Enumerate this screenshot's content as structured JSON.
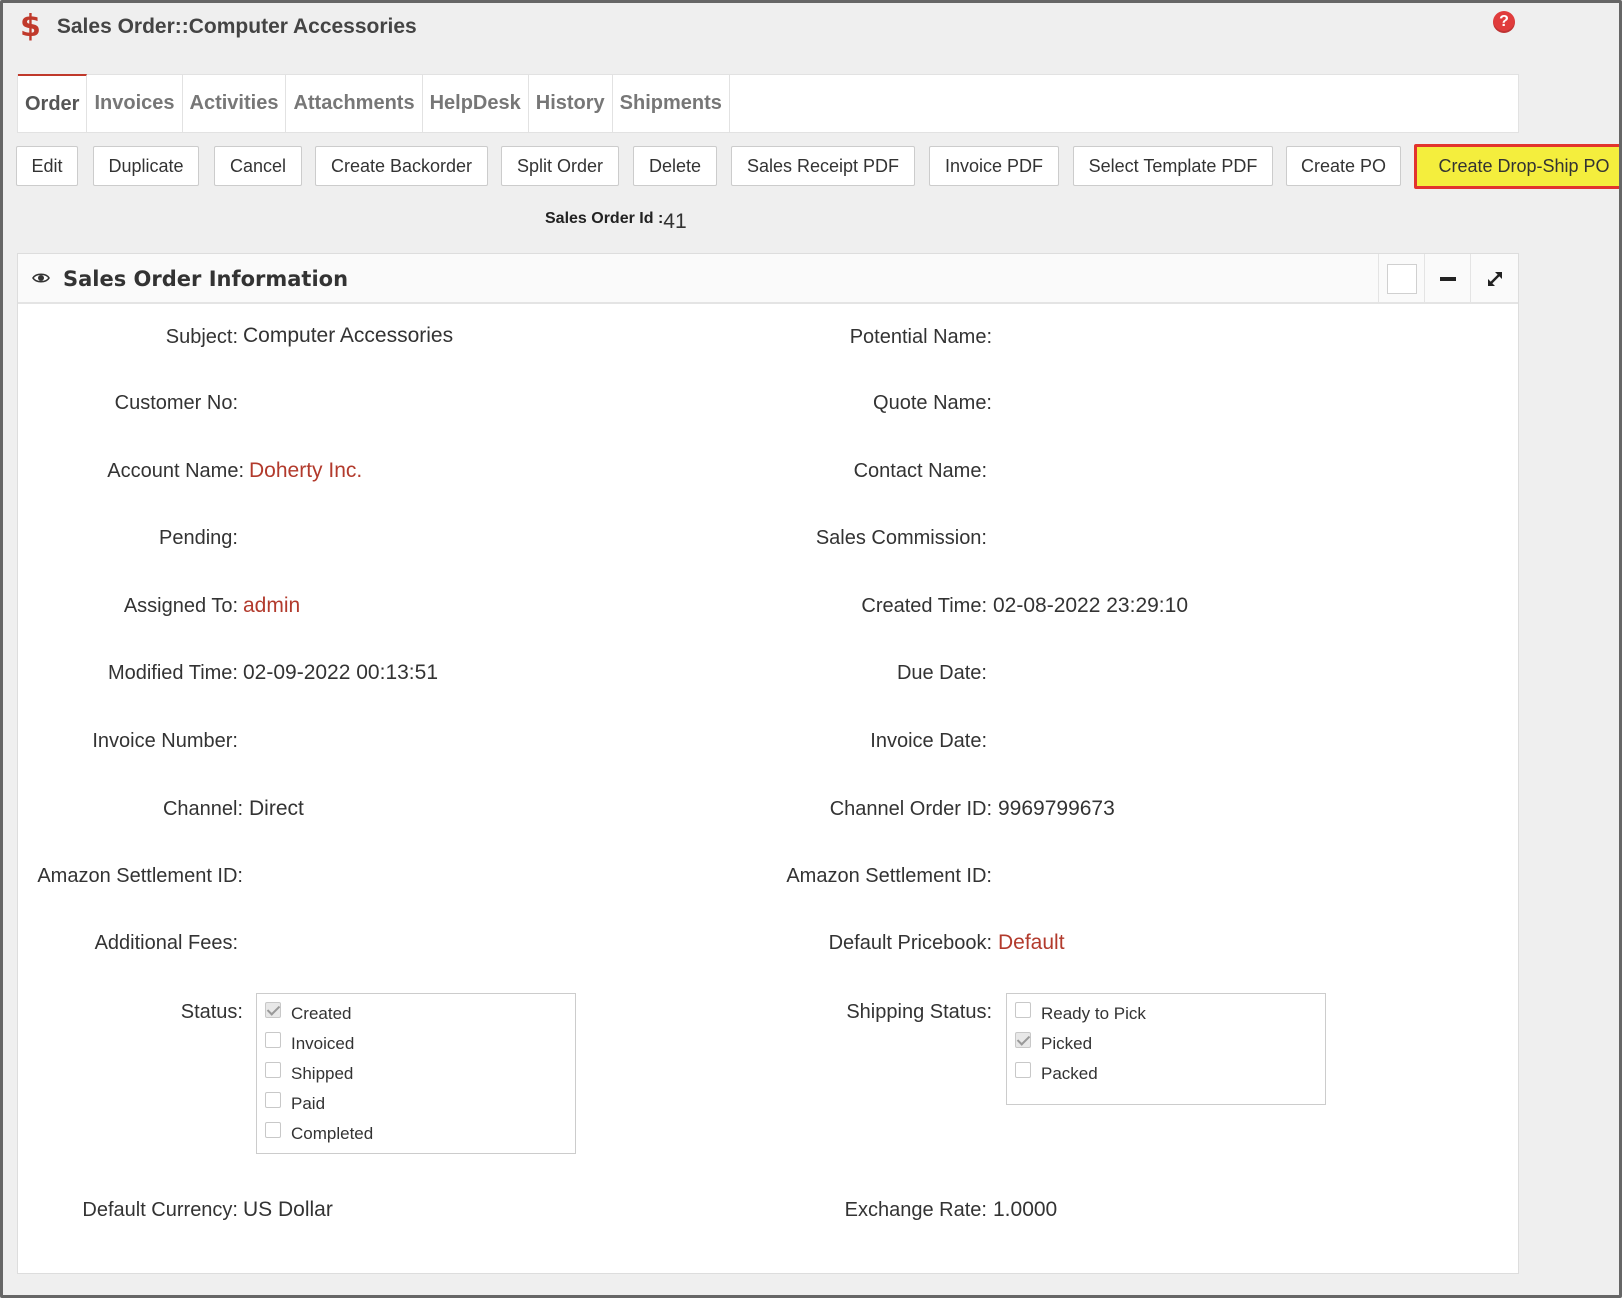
{
  "header": {
    "icon": "dollar-icon",
    "title": "Sales Order::Computer Accessories",
    "help_icon": "?"
  },
  "tabs": [
    {
      "label": "Order",
      "active": true
    },
    {
      "label": "Invoices"
    },
    {
      "label": "Activities"
    },
    {
      "label": "Attachments"
    },
    {
      "label": "HelpDesk"
    },
    {
      "label": "History"
    },
    {
      "label": "Shipments"
    }
  ],
  "toolbar": {
    "buttons": [
      {
        "label": "Edit"
      },
      {
        "label": "Duplicate"
      },
      {
        "label": "Cancel"
      },
      {
        "label": "Create Backorder"
      },
      {
        "label": "Split Order"
      },
      {
        "label": "Delete"
      },
      {
        "label": "Sales Receipt PDF"
      },
      {
        "label": "Invoice PDF"
      },
      {
        "label": "Select Template PDF"
      },
      {
        "label": "Create PO"
      },
      {
        "label": "Create Drop-Ship PO",
        "highlighted": true
      }
    ]
  },
  "sales_order_id": {
    "label": "Sales Order Id :",
    "value": "41"
  },
  "panel": {
    "title": "Sales Order Information",
    "icon": "eye-icon"
  },
  "fields": {
    "subject": {
      "label": "Subject:",
      "value": "Computer Accessories"
    },
    "potential_name": {
      "label": "Potential Name:",
      "value": ""
    },
    "customer_no": {
      "label": "Customer No:",
      "value": ""
    },
    "quote_name": {
      "label": "Quote Name:",
      "value": ""
    },
    "account_name": {
      "label": "Account Name:",
      "value": "Doherty Inc."
    },
    "contact_name": {
      "label": "Contact Name:",
      "value": ""
    },
    "pending": {
      "label": "Pending:",
      "value": ""
    },
    "sales_commission": {
      "label": "Sales Commission:",
      "value": ""
    },
    "assigned_to": {
      "label": "Assigned To:",
      "value": "admin"
    },
    "created_time": {
      "label": "Created Time:",
      "value": "02-08-2022 23:29:10"
    },
    "modified_time": {
      "label": "Modified Time:",
      "value": "02-09-2022 00:13:51"
    },
    "due_date": {
      "label": "Due Date:",
      "value": ""
    },
    "invoice_number": {
      "label": "Invoice Number:",
      "value": ""
    },
    "invoice_date": {
      "label": "Invoice Date:",
      "value": ""
    },
    "channel": {
      "label": "Channel:",
      "value": "Direct"
    },
    "channel_order_id": {
      "label": "Channel Order ID:",
      "value": "9969799673"
    },
    "amazon_settlement_id_left": {
      "label": "Amazon Settlement ID:",
      "value": ""
    },
    "amazon_settlement_id_right": {
      "label": "Amazon Settlement ID:",
      "value": ""
    },
    "additional_fees": {
      "label": "Additional Fees:",
      "value": ""
    },
    "default_pricebook": {
      "label": "Default Pricebook:",
      "value": "Default"
    },
    "status": {
      "label": "Status:",
      "options": [
        {
          "label": "Created",
          "checked": true
        },
        {
          "label": "Invoiced",
          "checked": false
        },
        {
          "label": "Shipped",
          "checked": false
        },
        {
          "label": "Paid",
          "checked": false
        },
        {
          "label": "Completed",
          "checked": false
        }
      ]
    },
    "shipping_status": {
      "label": "Shipping Status:",
      "options": [
        {
          "label": "Ready to Pick",
          "checked": false
        },
        {
          "label": "Picked",
          "checked": true
        },
        {
          "label": "Packed",
          "checked": false
        }
      ]
    },
    "default_currency": {
      "label": "Default Currency:",
      "value": "US Dollar"
    },
    "exchange_rate": {
      "label": "Exchange Rate:",
      "value": "1.0000"
    }
  }
}
